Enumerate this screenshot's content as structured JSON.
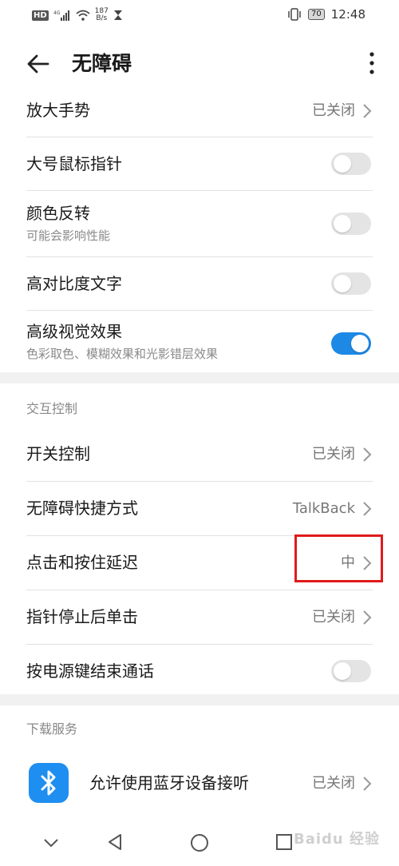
{
  "status_bar": {
    "hd": "HD",
    "net_speed_value": "187",
    "net_speed_unit": "B/s",
    "battery": "70",
    "time": "12:48"
  },
  "header": {
    "title": "无障碍"
  },
  "items": [
    {
      "title": "放大手势",
      "value": "已关闭"
    },
    {
      "title": "大号鼠标指针",
      "toggle": false
    },
    {
      "title": "颜色反转",
      "subtitle": "可能会影响性能",
      "toggle": false
    },
    {
      "title": "高对比度文字",
      "toggle": false
    },
    {
      "title": "高级视觉效果",
      "subtitle": "色彩取色、模糊效果和光影错层效果",
      "toggle": true
    }
  ],
  "interaction": {
    "header": "交互控制",
    "items": [
      {
        "title": "开关控制",
        "value": "已关闭"
      },
      {
        "title": "无障碍快捷方式",
        "value": "TalkBack"
      },
      {
        "title": "点击和按住延迟",
        "value": "中"
      },
      {
        "title": "指针停止后单击",
        "value": "已关闭"
      },
      {
        "title": "按电源键结束通话",
        "toggle": false
      }
    ]
  },
  "download": {
    "header": "下载服务",
    "items": [
      {
        "title": "允许使用蓝牙设备接听",
        "value": "已关闭"
      }
    ]
  },
  "watermark": "Baidu 经验",
  "colors": {
    "accent": "#1e88e5",
    "highlight": "#e01b1b",
    "bluetooth": "#1e8ef0"
  }
}
